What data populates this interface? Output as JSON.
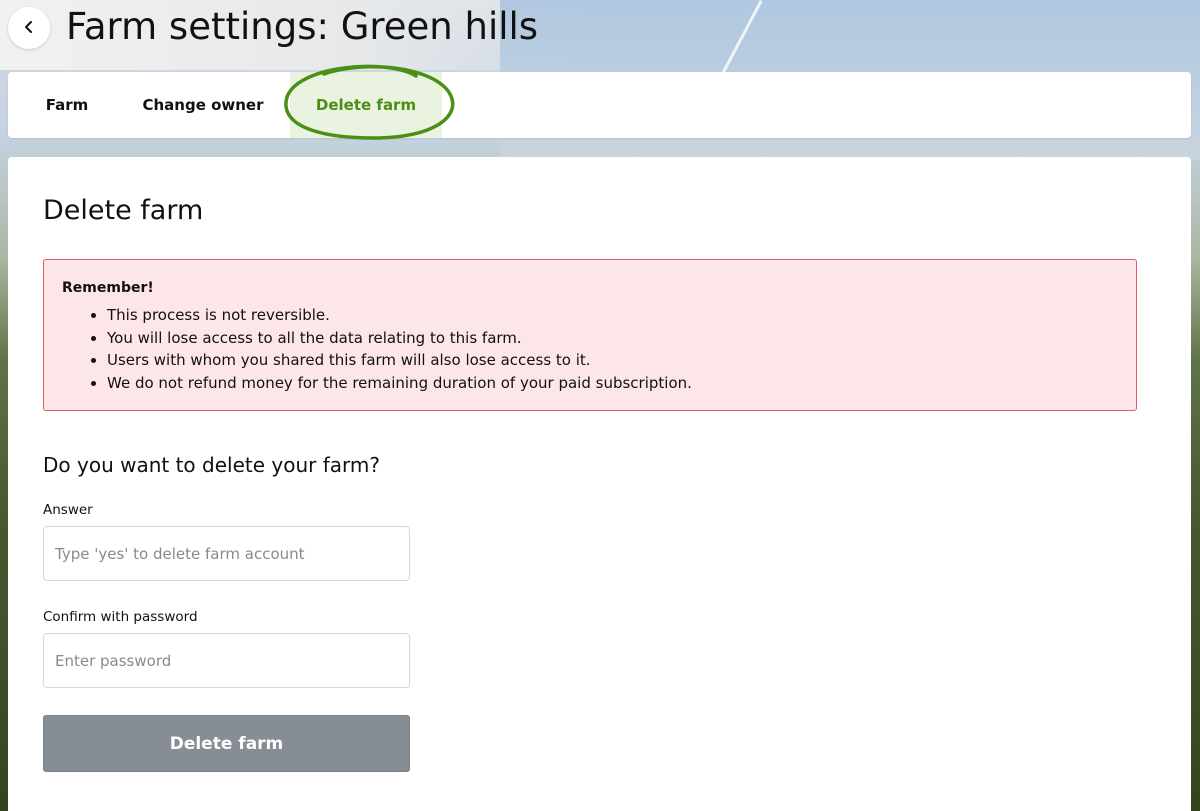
{
  "header": {
    "title": "Farm settings: Green hills"
  },
  "tabs": [
    {
      "label": "Farm"
    },
    {
      "label": "Change owner"
    },
    {
      "label": "Delete farm"
    }
  ],
  "main": {
    "section_title": "Delete farm",
    "alert": {
      "title": "Remember!",
      "items": [
        "This process is not reversible.",
        "You will lose access to all the data relating to this farm.",
        "Users with whom you shared this farm will also lose access to it.",
        "We do not refund money for the remaining duration of your paid subscription."
      ]
    },
    "question": "Do you want to delete your farm?",
    "answer_field": {
      "label": "Answer",
      "placeholder": "Type 'yes' to delete farm account",
      "value": ""
    },
    "password_field": {
      "label": "Confirm with password",
      "placeholder": "Enter password",
      "value": ""
    },
    "delete_button_label": "Delete farm"
  },
  "icons": {
    "back": "chevron-left-icon"
  },
  "colors": {
    "accent_green": "#4a8f16",
    "active_tab_bg": "#e9f3df",
    "alert_bg": "#fde6e7",
    "alert_border": "#e05a5f",
    "button_disabled": "#868d94"
  }
}
